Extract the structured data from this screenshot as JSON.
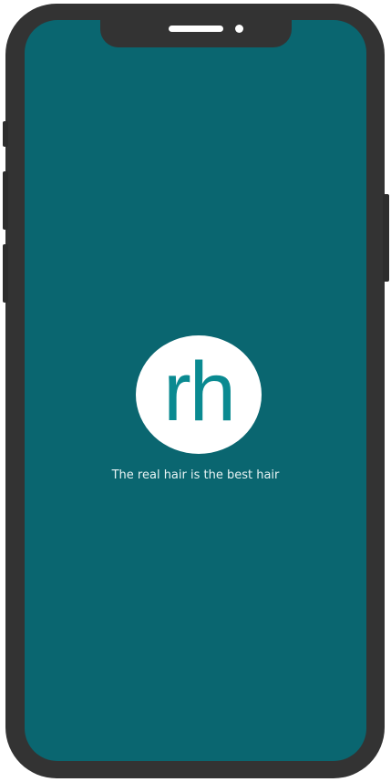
{
  "splash": {
    "logo_text": "rh",
    "tagline": "The real hair is the best hair"
  },
  "colors": {
    "background": "#0a6670",
    "logo_circle": "#ffffff",
    "logo_text": "#0a8a91",
    "tagline": "#e9f4f5",
    "device_frame": "#333333"
  },
  "icons": {
    "logo": "rh-logo"
  }
}
